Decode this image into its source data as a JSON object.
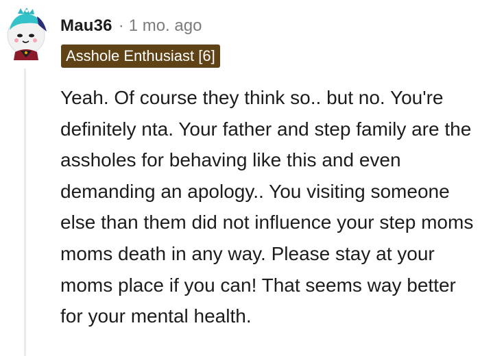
{
  "comment": {
    "username": "Mau36",
    "separator": "·",
    "timestamp": "1 mo. ago",
    "flair": "Asshole Enthusiast [6]",
    "body": "Yeah. Of course they think so.. but no. You're definitely nta. Your father and step family are the assholes for behaving like this and even demanding an apology.. You visiting someone else than them did not influence your step moms moms death in any way. Please stay at your moms place if you can! That seems way better for your mental health.",
    "avatar_icon": "snoo-avatar-icon"
  },
  "colors": {
    "flair_background": "#5f4317",
    "flair_text": "#ffffff",
    "username": "#1c1c1c",
    "meta_gray": "#7c7c7c",
    "thread_line": "#e8eaec"
  }
}
